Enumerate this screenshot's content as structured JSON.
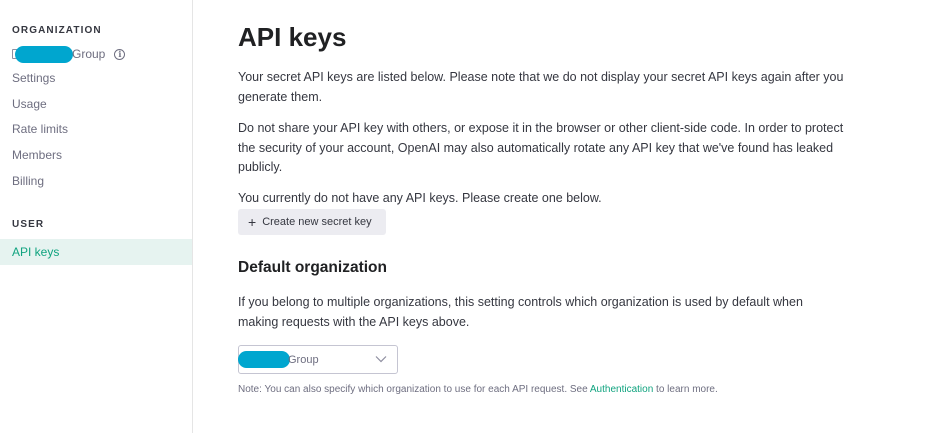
{
  "sidebar": {
    "organization_heading": "ORGANIZATION",
    "org_name_suffix": "Group",
    "items": [
      {
        "label": "Settings"
      },
      {
        "label": "Usage"
      },
      {
        "label": "Rate limits"
      },
      {
        "label": "Members"
      },
      {
        "label": "Billing"
      }
    ],
    "user_heading": "USER",
    "user_items": [
      {
        "label": "API keys",
        "active": true
      }
    ]
  },
  "main": {
    "title": "API keys",
    "intro": "Your secret API keys are listed below. Please note that we do not display your secret API keys again after you generate them.",
    "warning": "Do not share your API key with others, or expose it in the browser or other client-side code. In order to protect the security of your account, OpenAI may also automatically rotate any API key that we've found has leaked publicly.",
    "empty_state": "You currently do not have any API keys. Please create one below.",
    "create_button": "Create new secret key",
    "default_org": {
      "title": "Default organization",
      "description": "If you belong to multiple organizations, this setting controls which organization is used by default when making requests with the API keys above.",
      "select_value_suffix": "Group",
      "note_prefix": "Note: You can also specify which organization to use for each API request. See ",
      "note_link": "Authentication",
      "note_suffix": " to learn more."
    }
  },
  "colors": {
    "accent": "#10a37f",
    "active_bg": "#e6f3f0",
    "redaction": "#00a6cf",
    "button_bg": "#ececf1"
  },
  "icons": {
    "info": "info-icon",
    "plus": "plus-icon",
    "chevron": "chevron-down-icon"
  }
}
